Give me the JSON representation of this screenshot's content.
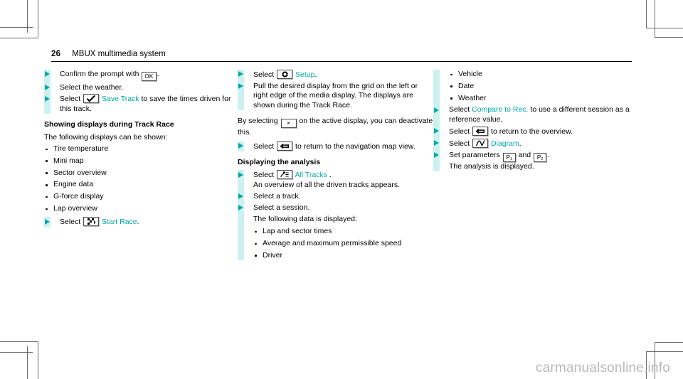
{
  "header": {
    "page_number": "26",
    "chapter_title": "MBUX multimedia system"
  },
  "column1": {
    "steps_top": [
      {
        "prefix": "Confirm the prompt with ",
        "icon": "ok-button",
        "icon_label": "OK",
        "suffix": "."
      },
      {
        "prefix": "Select the weather.",
        "icon": "",
        "icon_label": "",
        "suffix": ""
      },
      {
        "prefix": "Select ",
        "icon": "checkmark-icon",
        "icon_label": "",
        "link": "Save Track",
        "suffix": " to save the times driven for this track."
      }
    ],
    "subhead": "Showing displays during Track Race",
    "intro": "The following displays can be shown:",
    "bullets": [
      "Tire temperature",
      "Mini map",
      "Sector overview",
      "Engine data",
      "G-force display",
      "Lap overview"
    ],
    "step_start_race": {
      "prefix": "Select ",
      "icon": "checkered-flag-icon",
      "link": "Start Race",
      "suffix": "."
    }
  },
  "column2": {
    "step_setup": {
      "prefix": "Select ",
      "icon": "gear-icon",
      "link": "Setup",
      "suffix": "."
    },
    "step_pull": "Pull the desired display from the grid on the left or right edge of the media display. The displays are shown during the Track Race.",
    "deactivate_para_prefix": "By selecting ",
    "deactivate_icon": "close-x-icon",
    "deactivate_icon_label": "×",
    "deactivate_para_suffix": " on the active display, you can deactivate this.",
    "step_back": {
      "prefix": "Select ",
      "icon": "back-arrow-icon",
      "suffix": " to return to the navigation map view."
    },
    "subhead": "Displaying the analysis",
    "step_all_tracks": {
      "prefix": "Select ",
      "icon": "all-tracks-icon",
      "link": "All Tracks",
      "suffix": " ."
    },
    "all_tracks_note": "An overview of all the driven tracks appears.",
    "step_select_track": "Select a track.",
    "step_select_session": "Select a session.",
    "following_data": "The following data is displayed:",
    "bullets": [
      "Lap and sector times",
      "Average and maximum permissible speed",
      "Driver"
    ]
  },
  "column3": {
    "bullets": [
      "Vehicle",
      "Date",
      "Weather"
    ],
    "step_compare": {
      "prefix": "Select ",
      "link": "Compare to Rec.",
      "suffix": " to use a different session as a reference value."
    },
    "step_overview": {
      "prefix": "Select ",
      "icon": "back-arrow-icon",
      "suffix": " to return to the overview."
    },
    "step_diagram": {
      "prefix": "Select ",
      "icon": "diagram-curve-icon",
      "link": "Diagram",
      "suffix": "."
    },
    "step_parameters": {
      "prefix": "Set parameters ",
      "icon1_label": "P",
      "icon1_sub": "1",
      "middle": " and ",
      "icon2_label": "P",
      "icon2_sub": "2",
      "suffix": "."
    },
    "analysis_note": "The analysis is displayed."
  },
  "watermark": "carmanualsonline.info",
  "colors": {
    "accent_teal": "#00a9a7",
    "accent_bar": "#ccf2f0",
    "text": "#000000",
    "watermark": "#b9b9b9"
  }
}
